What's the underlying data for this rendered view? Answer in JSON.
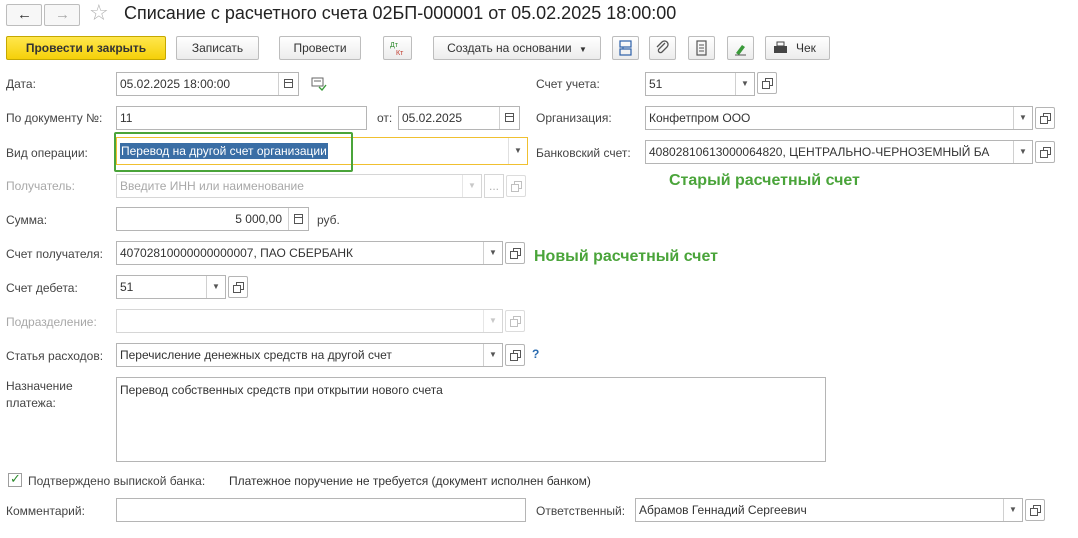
{
  "window": {
    "title": "Списание с расчетного счета 02БП-000001 от 05.02.2025 18:00:00",
    "back_icon": "←",
    "forward_icon": "→",
    "star_icon": "☆"
  },
  "toolbar": {
    "post_close": "Провести и закрыть",
    "save": "Записать",
    "post": "Провести",
    "dt_kt": "Дт Кт",
    "create_based": "Создать на основании",
    "check": "Чек"
  },
  "fields": {
    "date": {
      "label": "Дата:",
      "value": "05.02.2025 18:00:00"
    },
    "account": {
      "label": "Счет учета:",
      "value": "51"
    },
    "doc_number": {
      "label": "По документу №:",
      "value": "11"
    },
    "doc_date": {
      "label": "от:",
      "value": "05.02.2025"
    },
    "organization": {
      "label": "Организация:",
      "value": "Конфетпром ООО"
    },
    "operation_type": {
      "label": "Вид операции:",
      "value": "Перевод на другой счет организации"
    },
    "bank_account": {
      "label": "Банковский счет:",
      "value": "40802810613000064820, ЦЕНТРАЛЬНО-ЧЕРНОЗЕМНЫЙ БА"
    },
    "recipient": {
      "label": "Получатель:",
      "placeholder": "Введите ИНН или наименование"
    },
    "amount": {
      "label": "Сумма:",
      "value": "5 000,00",
      "unit": "руб."
    },
    "recipient_account": {
      "label": "Счет получателя:",
      "value": "40702810000000000007, ПАО СБЕРБАНК"
    },
    "debit_account": {
      "label": "Счет дебета:",
      "value": "51"
    },
    "division": {
      "label": "Подразделение:"
    },
    "expense_item": {
      "label": "Статья расходов:",
      "value": "Перечисление денежных средств на другой счет",
      "help": "?"
    },
    "payment_purpose": {
      "label_line1": "Назначение",
      "label_line2": "платежа:",
      "value": "Перевод собственных средств при открытии нового счета"
    },
    "confirmed": {
      "label": "Подтверждено выпиской банка:",
      "status": "Платежное поручение не требуется (документ исполнен банком)",
      "checked": true
    },
    "comment": {
      "label": "Комментарий:",
      "value": ""
    },
    "responsible": {
      "label": "Ответственный:",
      "value": "Абрамов Геннадий Сергеевич"
    }
  },
  "annotations": {
    "old_account": "Старый расчетный счет",
    "new_account": "Новый расчетный счет",
    "color": "#4aa43a"
  },
  "colors": {
    "primary_button": "#f5d009",
    "selection": "#3a6ea5",
    "focus_border": "#f0c030",
    "highlight_box": "#4aa43a"
  }
}
